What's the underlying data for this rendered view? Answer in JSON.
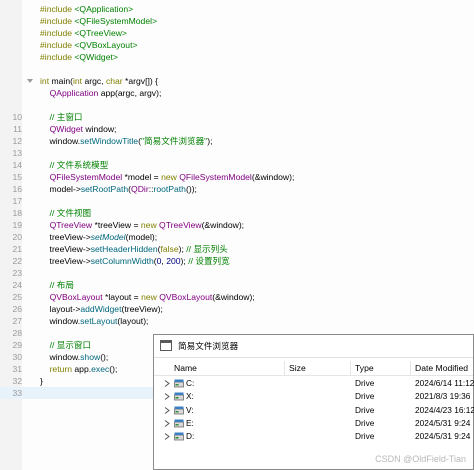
{
  "editor": {
    "current_line": 33,
    "lines": [
      {
        "n": "",
        "tokens": [
          [
            "#include ",
            "kw"
          ],
          [
            "<QApplication>",
            "str"
          ]
        ]
      },
      {
        "n": "",
        "tokens": [
          [
            "#include ",
            "kw"
          ],
          [
            "<QFileSystemModel>",
            "str"
          ]
        ]
      },
      {
        "n": "",
        "tokens": [
          [
            "#include ",
            "kw"
          ],
          [
            "<QTreeView>",
            "str"
          ]
        ]
      },
      {
        "n": "",
        "tokens": [
          [
            "#include ",
            "kw"
          ],
          [
            "<QVBoxLayout>",
            "str"
          ]
        ]
      },
      {
        "n": "",
        "tokens": [
          [
            "#include ",
            "kw"
          ],
          [
            "<QWidget>",
            "str"
          ]
        ]
      },
      {
        "n": "",
        "tokens": []
      },
      {
        "n": "",
        "fold": true,
        "tokens": [
          [
            "int ",
            "kw"
          ],
          [
            "main(",
            ""
          ],
          [
            "int ",
            "kw"
          ],
          [
            "argc, ",
            ""
          ],
          [
            "char ",
            "kw"
          ],
          [
            "*argv[]) {",
            ""
          ]
        ]
      },
      {
        "n": "",
        "tokens": [
          [
            "    ",
            ""
          ],
          [
            "QApplication ",
            "cls"
          ],
          [
            "app(argc, argv);",
            ""
          ]
        ]
      },
      {
        "n": "",
        "tokens": []
      },
      {
        "n": "10",
        "tokens": [
          [
            "    ",
            ""
          ],
          [
            "// 主窗口",
            "cm"
          ]
        ]
      },
      {
        "n": "11",
        "tokens": [
          [
            "    ",
            ""
          ],
          [
            "QWidget ",
            "cls"
          ],
          [
            "window;",
            ""
          ]
        ]
      },
      {
        "n": "12",
        "tokens": [
          [
            "    window.",
            ""
          ],
          [
            "setWindowTitle",
            "fn"
          ],
          [
            "(",
            ""
          ],
          [
            "\"简易文件浏览器\"",
            "str"
          ],
          [
            ");",
            ""
          ]
        ]
      },
      {
        "n": "13",
        "tokens": []
      },
      {
        "n": "14",
        "tokens": [
          [
            "    ",
            ""
          ],
          [
            "// 文件系统模型",
            "cm"
          ]
        ]
      },
      {
        "n": "15",
        "tokens": [
          [
            "    ",
            ""
          ],
          [
            "QFileSystemModel ",
            "cls"
          ],
          [
            "*model = ",
            ""
          ],
          [
            "new ",
            "kw"
          ],
          [
            "QFileSystemModel",
            "cls"
          ],
          [
            "(&window);",
            ""
          ]
        ]
      },
      {
        "n": "16",
        "tokens": [
          [
            "    model->",
            ""
          ],
          [
            "setRootPath",
            "fn"
          ],
          [
            "(",
            ""
          ],
          [
            "QDir",
            "cls"
          ],
          [
            "::",
            ""
          ],
          [
            "rootPath",
            "fn"
          ],
          [
            "());",
            ""
          ]
        ]
      },
      {
        "n": "17",
        "tokens": []
      },
      {
        "n": "18",
        "tokens": [
          [
            "    ",
            ""
          ],
          [
            "// 文件视图",
            "cm"
          ]
        ]
      },
      {
        "n": "19",
        "tokens": [
          [
            "    ",
            ""
          ],
          [
            "QTreeView ",
            "cls"
          ],
          [
            "*treeView = ",
            ""
          ],
          [
            "new ",
            "kw"
          ],
          [
            "QTreeView",
            "cls"
          ],
          [
            "(&window);",
            ""
          ]
        ]
      },
      {
        "n": "20",
        "tokens": [
          [
            "    treeView->",
            ""
          ],
          [
            "setModel",
            "fn it"
          ],
          [
            "(model);",
            ""
          ]
        ]
      },
      {
        "n": "21",
        "tokens": [
          [
            "    treeView->",
            ""
          ],
          [
            "setHeaderHidden",
            "fn"
          ],
          [
            "(",
            ""
          ],
          [
            "false",
            "kw"
          ],
          [
            "); ",
            ""
          ],
          [
            "// 显示列头",
            "cm"
          ]
        ]
      },
      {
        "n": "22",
        "tokens": [
          [
            "    treeView->",
            ""
          ],
          [
            "setColumnWidth",
            "fn"
          ],
          [
            "(",
            ""
          ],
          [
            "0",
            "num"
          ],
          [
            ", ",
            ""
          ],
          [
            "200",
            "num"
          ],
          [
            "); ",
            ""
          ],
          [
            "// 设置列宽",
            "cm"
          ]
        ]
      },
      {
        "n": "23",
        "tokens": []
      },
      {
        "n": "24",
        "tokens": [
          [
            "    ",
            ""
          ],
          [
            "// 布局",
            "cm"
          ]
        ]
      },
      {
        "n": "25",
        "tokens": [
          [
            "    ",
            ""
          ],
          [
            "QVBoxLayout ",
            "cls"
          ],
          [
            "*layout = ",
            ""
          ],
          [
            "new ",
            "kw"
          ],
          [
            "QVBoxLayout",
            "cls"
          ],
          [
            "(&window);",
            ""
          ]
        ]
      },
      {
        "n": "26",
        "tokens": [
          [
            "    layout->",
            ""
          ],
          [
            "addWidget",
            "fn"
          ],
          [
            "(treeView);",
            ""
          ]
        ]
      },
      {
        "n": "27",
        "tokens": [
          [
            "    window.",
            ""
          ],
          [
            "setLayout",
            "fn"
          ],
          [
            "(layout);",
            ""
          ]
        ]
      },
      {
        "n": "28",
        "tokens": []
      },
      {
        "n": "29",
        "tokens": [
          [
            "    ",
            ""
          ],
          [
            "// 显示窗口",
            "cm"
          ]
        ]
      },
      {
        "n": "30",
        "tokens": [
          [
            "    window.",
            ""
          ],
          [
            "show",
            "fn"
          ],
          [
            "();",
            ""
          ]
        ]
      },
      {
        "n": "31",
        "tokens": [
          [
            "    ",
            ""
          ],
          [
            "return ",
            "kw"
          ],
          [
            "app.",
            ""
          ],
          [
            "exec",
            "fn"
          ],
          [
            "();",
            ""
          ]
        ]
      },
      {
        "n": "32",
        "tokens": [
          [
            "}",
            ""
          ]
        ]
      },
      {
        "n": "33",
        "tokens": []
      }
    ]
  },
  "app_window": {
    "title": "简易文件浏览器",
    "columns": {
      "name": "Name",
      "size": "Size",
      "type": "Type",
      "date": "Date Modified"
    },
    "rows": [
      {
        "name": "C:",
        "size": "",
        "type": "Drive",
        "date": "2024/6/14 11:12"
      },
      {
        "name": "X:",
        "size": "",
        "type": "Drive",
        "date": "2021/8/3 19:36"
      },
      {
        "name": "V:",
        "size": "",
        "type": "Drive",
        "date": "2024/4/23 16:12"
      },
      {
        "name": "E:",
        "size": "",
        "type": "Drive",
        "date": "2024/5/31 9:24"
      },
      {
        "name": "D:",
        "size": "",
        "type": "Drive",
        "date": "2024/5/31 9:24"
      }
    ]
  },
  "watermark": "CSDN @OldField-Tian",
  "colors": {
    "keyword": "#808000",
    "class": "#800080",
    "string": "#008000",
    "comment": "#008000",
    "function": "#00677c",
    "number": "#000080"
  }
}
